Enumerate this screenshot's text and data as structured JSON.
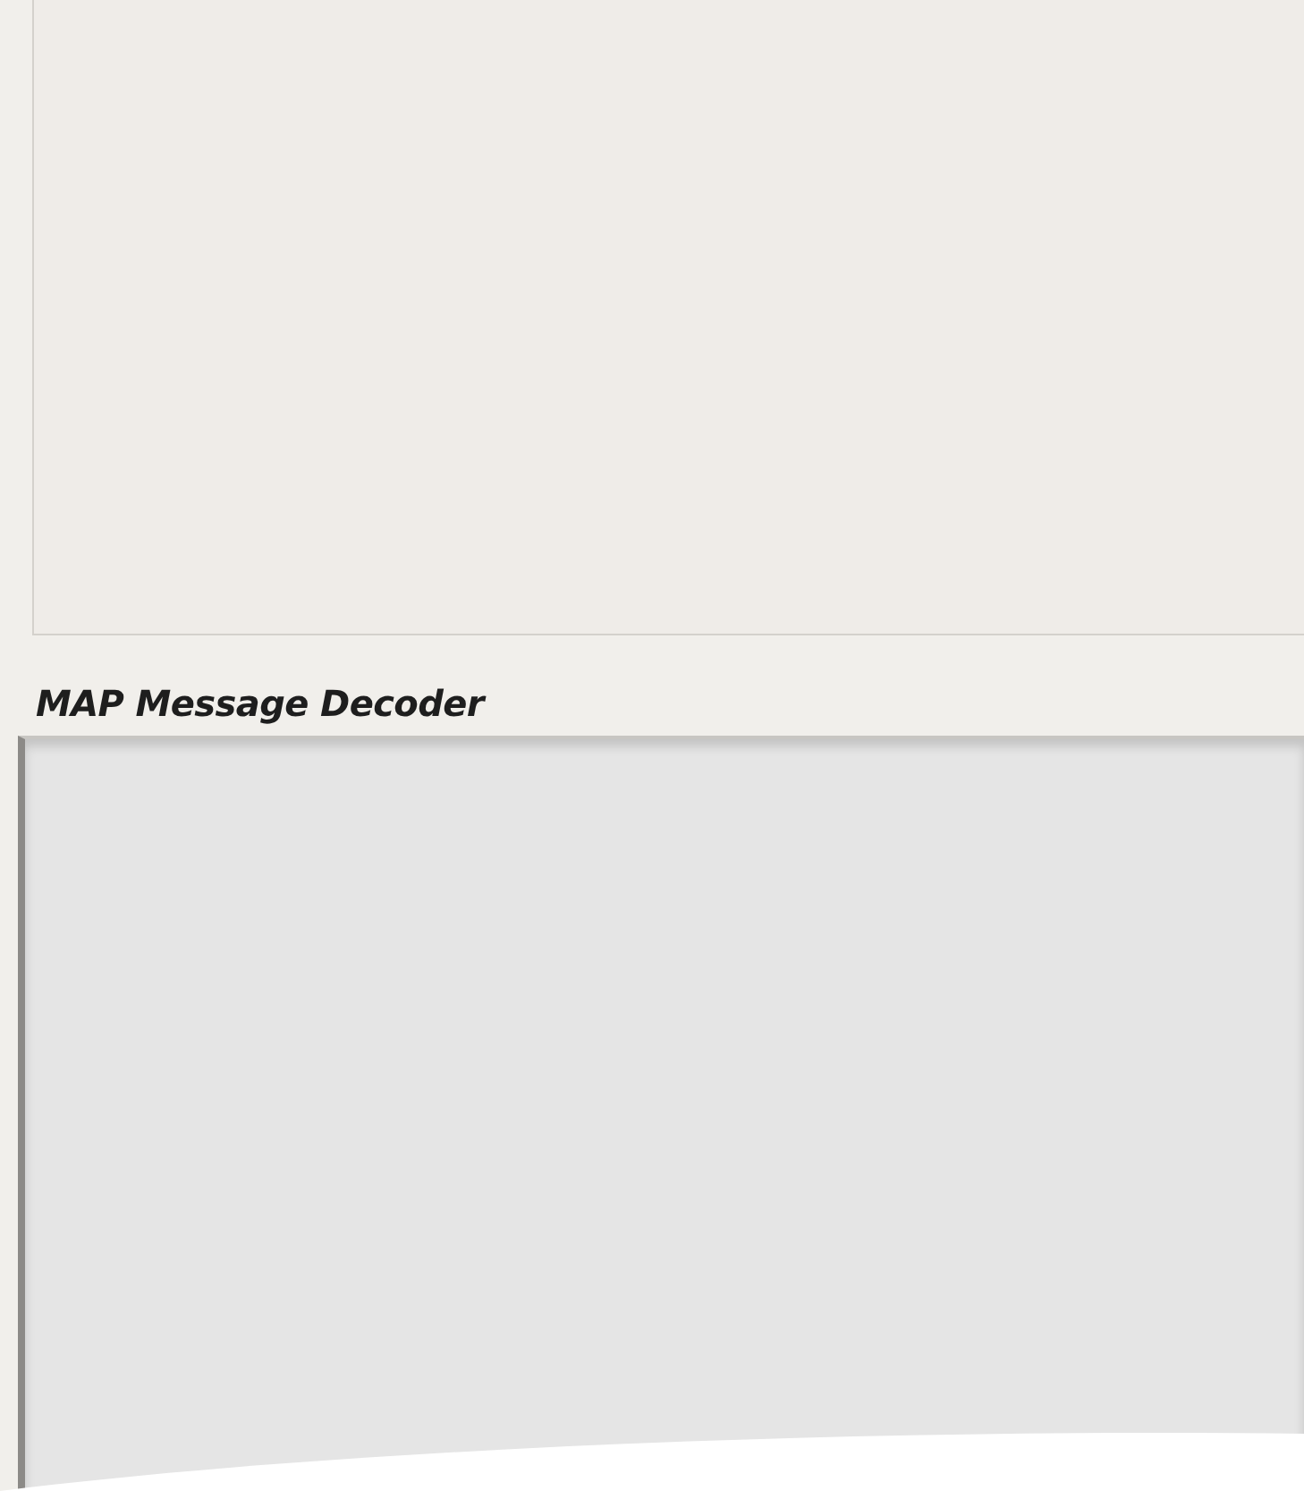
{
  "decoder": {
    "title": "MAP Message Decoder"
  }
}
